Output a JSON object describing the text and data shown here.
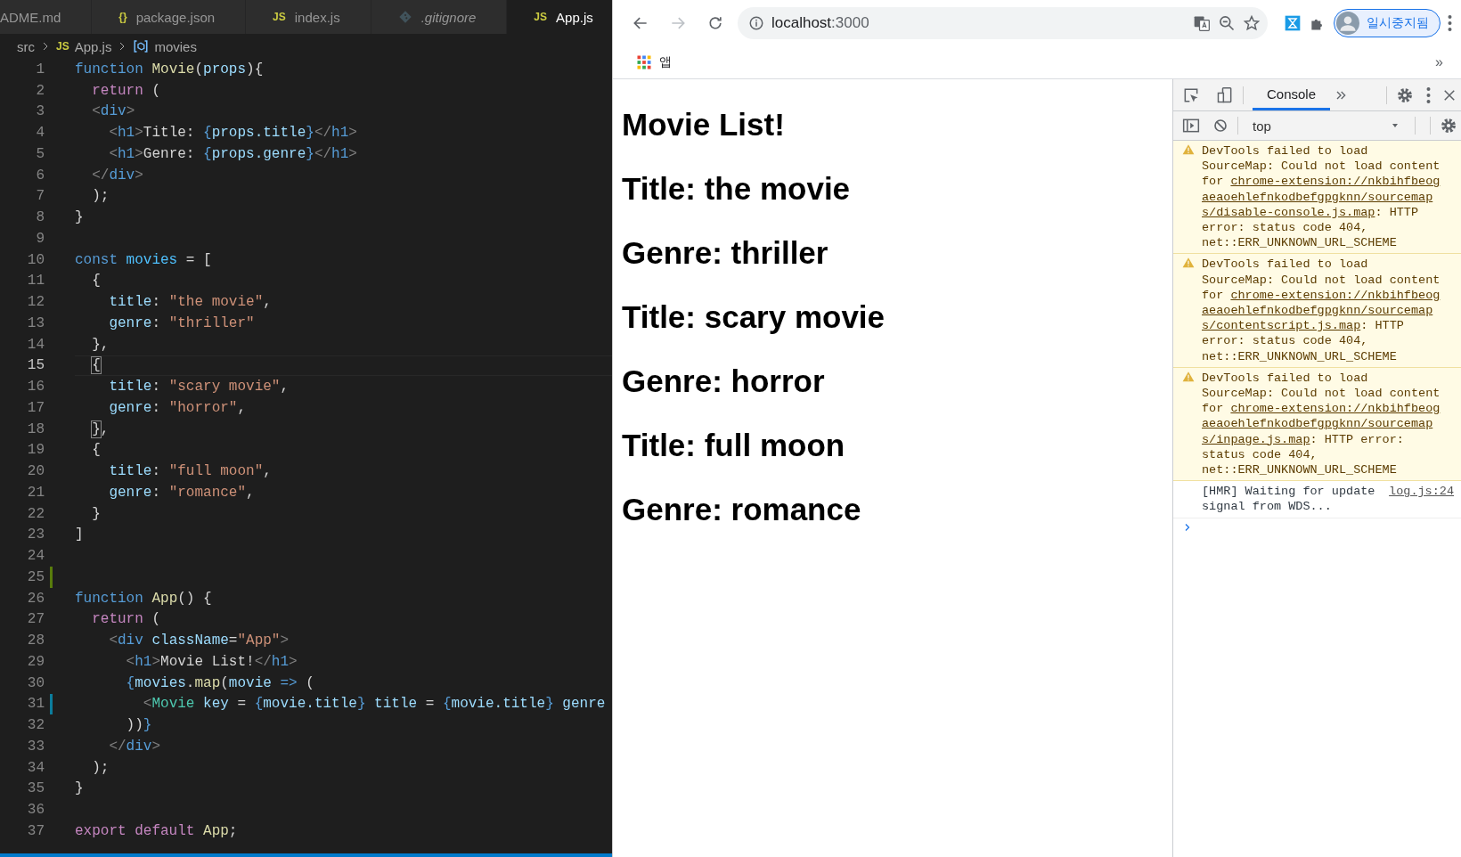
{
  "editor": {
    "tabs": [
      {
        "label": "ADME.md",
        "selected": false,
        "preview": false
      },
      {
        "badge": "{}",
        "label": "package.json",
        "selected": false,
        "preview": false
      },
      {
        "badge": "JS",
        "label": "index.js",
        "selected": false,
        "preview": false
      },
      {
        "kind": "git",
        "label": ".gitignore",
        "selected": false,
        "preview": true
      },
      {
        "badge": "JS",
        "label": "App.js",
        "selected": true,
        "preview": false
      }
    ],
    "breadcrumb": [
      {
        "label": "src"
      },
      {
        "badge": "JS",
        "label": "App.js"
      },
      {
        "kind": "variable",
        "label": "movies"
      }
    ],
    "lines": [
      {
        "number": "1",
        "tokens": [
          {
            "kind": "kw",
            "text": "function "
          },
          {
            "kind": "fn",
            "text": "Movie"
          },
          {
            "kind": "punc",
            "text": "("
          },
          {
            "kind": "var",
            "text": "props"
          },
          {
            "kind": "punc",
            "text": "){"
          }
        ]
      },
      {
        "number": "2",
        "tokens": [
          {
            "kind": "ctrl",
            "text": "  return"
          },
          {
            "kind": "punc",
            "text": " ("
          }
        ]
      },
      {
        "number": "3",
        "tokens": [
          {
            "kind": "tag",
            "text": "  <"
          },
          {
            "kind": "kw",
            "text": "div"
          },
          {
            "kind": "tag",
            "text": ">"
          }
        ]
      },
      {
        "number": "4",
        "tokens": [
          {
            "kind": "tag",
            "text": "    <"
          },
          {
            "kind": "kw",
            "text": "h1"
          },
          {
            "kind": "tag",
            "text": ">"
          },
          {
            "kind": "punc",
            "text": "Title: "
          },
          {
            "kind": "kw",
            "text": "{"
          },
          {
            "kind": "var",
            "text": "props.title"
          },
          {
            "kind": "kw",
            "text": "}"
          },
          {
            "kind": "tag",
            "text": "</"
          },
          {
            "kind": "kw",
            "text": "h1"
          },
          {
            "kind": "tag",
            "text": ">"
          }
        ]
      },
      {
        "number": "5",
        "tokens": [
          {
            "kind": "tag",
            "text": "    <"
          },
          {
            "kind": "kw",
            "text": "h1"
          },
          {
            "kind": "tag",
            "text": ">"
          },
          {
            "kind": "punc",
            "text": "Genre: "
          },
          {
            "kind": "kw",
            "text": "{"
          },
          {
            "kind": "var",
            "text": "props.genre"
          },
          {
            "kind": "kw",
            "text": "}"
          },
          {
            "kind": "tag",
            "text": "</"
          },
          {
            "kind": "kw",
            "text": "h1"
          },
          {
            "kind": "tag",
            "text": ">"
          }
        ]
      },
      {
        "number": "6",
        "tokens": [
          {
            "kind": "tag",
            "text": "  </"
          },
          {
            "kind": "kw",
            "text": "div"
          },
          {
            "kind": "tag",
            "text": ">"
          }
        ]
      },
      {
        "number": "7",
        "tokens": [
          {
            "kind": "punc",
            "text": "  );"
          }
        ]
      },
      {
        "number": "8",
        "tokens": [
          {
            "kind": "punc",
            "text": "}"
          }
        ]
      },
      {
        "number": "9"
      },
      {
        "number": "10",
        "tokens": [
          {
            "kind": "kw",
            "text": "const "
          },
          {
            "kind": "const",
            "text": "movies"
          },
          {
            "kind": "punc",
            "text": " = ["
          }
        ]
      },
      {
        "number": "11",
        "tokens": [
          {
            "kind": "punc",
            "text": "  {"
          }
        ]
      },
      {
        "number": "12",
        "tokens": [
          {
            "kind": "var",
            "text": "    title"
          },
          {
            "kind": "punc",
            "text": ": "
          },
          {
            "kind": "str",
            "text": "\"the movie\""
          },
          {
            "kind": "punc",
            "text": ","
          }
        ]
      },
      {
        "number": "13",
        "tokens": [
          {
            "kind": "var",
            "text": "    genre"
          },
          {
            "kind": "punc",
            "text": ": "
          },
          {
            "kind": "str",
            "text": "\"thriller\""
          }
        ]
      },
      {
        "number": "14",
        "tokens": [
          {
            "kind": "punc",
            "text": "  },"
          }
        ]
      },
      {
        "number": "15",
        "current": true,
        "tokens": [
          {
            "kind": "punc",
            "text": "  {",
            "match": true
          }
        ]
      },
      {
        "number": "16",
        "tokens": [
          {
            "kind": "var",
            "text": "    title"
          },
          {
            "kind": "punc",
            "text": ": "
          },
          {
            "kind": "str",
            "text": "\"scary movie\""
          },
          {
            "kind": "punc",
            "text": ","
          }
        ]
      },
      {
        "number": "17",
        "tokens": [
          {
            "kind": "var",
            "text": "    genre"
          },
          {
            "kind": "punc",
            "text": ": "
          },
          {
            "kind": "str",
            "text": "\"horror\""
          },
          {
            "kind": "punc",
            "text": ","
          }
        ]
      },
      {
        "number": "18",
        "tokens": [
          {
            "kind": "punc",
            "text": "  }",
            "match": true
          },
          {
            "kind": "punc",
            "text": ","
          }
        ]
      },
      {
        "number": "19",
        "tokens": [
          {
            "kind": "punc",
            "text": "  {"
          }
        ]
      },
      {
        "number": "20",
        "tokens": [
          {
            "kind": "var",
            "text": "    title"
          },
          {
            "kind": "punc",
            "text": ": "
          },
          {
            "kind": "str",
            "text": "\"full moon\""
          },
          {
            "kind": "punc",
            "text": ","
          }
        ]
      },
      {
        "number": "21",
        "tokens": [
          {
            "kind": "var",
            "text": "    genre"
          },
          {
            "kind": "punc",
            "text": ": "
          },
          {
            "kind": "str",
            "text": "\"romance\""
          },
          {
            "kind": "punc",
            "text": ","
          }
        ]
      },
      {
        "number": "22",
        "tokens": [
          {
            "kind": "punc",
            "text": "  }"
          }
        ]
      },
      {
        "number": "23",
        "tokens": [
          {
            "kind": "punc",
            "text": "]"
          }
        ]
      },
      {
        "number": "24"
      },
      {
        "number": "25",
        "added": true
      },
      {
        "number": "26",
        "tokens": [
          {
            "kind": "kw",
            "text": "function "
          },
          {
            "kind": "fn",
            "text": "App"
          },
          {
            "kind": "punc",
            "text": "() {"
          }
        ]
      },
      {
        "number": "27",
        "tokens": [
          {
            "kind": "ctrl",
            "text": "  return"
          },
          {
            "kind": "punc",
            "text": " ("
          }
        ]
      },
      {
        "number": "28",
        "tokens": [
          {
            "kind": "tag",
            "text": "    <"
          },
          {
            "kind": "kw",
            "text": "div"
          },
          {
            "kind": "var",
            "text": " className"
          },
          {
            "kind": "punc",
            "text": "="
          },
          {
            "kind": "str",
            "text": "\"App\""
          },
          {
            "kind": "tag",
            "text": ">"
          }
        ]
      },
      {
        "number": "29",
        "tokens": [
          {
            "kind": "tag",
            "text": "      <"
          },
          {
            "kind": "kw",
            "text": "h1"
          },
          {
            "kind": "tag",
            "text": ">"
          },
          {
            "kind": "punc",
            "text": "Movie List!"
          },
          {
            "kind": "tag",
            "text": "</"
          },
          {
            "kind": "kw",
            "text": "h1"
          },
          {
            "kind": "tag",
            "text": ">"
          }
        ]
      },
      {
        "number": "30",
        "tokens": [
          {
            "kind": "kw",
            "text": "      {"
          },
          {
            "kind": "var",
            "text": "movies"
          },
          {
            "kind": "punc",
            "text": "."
          },
          {
            "kind": "fn",
            "text": "map"
          },
          {
            "kind": "punc",
            "text": "("
          },
          {
            "kind": "var",
            "text": "movie"
          },
          {
            "kind": "kw",
            "text": " =>"
          },
          {
            "kind": "punc",
            "text": " ("
          }
        ]
      },
      {
        "number": "31",
        "modified": true,
        "tokens": [
          {
            "kind": "tag",
            "text": "        <"
          },
          {
            "kind": "comp",
            "text": "Movie"
          },
          {
            "kind": "var",
            "text": " key"
          },
          {
            "kind": "punc",
            "text": " = "
          },
          {
            "kind": "kw",
            "text": "{"
          },
          {
            "kind": "var",
            "text": "movie.title"
          },
          {
            "kind": "kw",
            "text": "}"
          },
          {
            "kind": "var",
            "text": " title"
          },
          {
            "kind": "punc",
            "text": " = "
          },
          {
            "kind": "kw",
            "text": "{"
          },
          {
            "kind": "var",
            "text": "movie.title"
          },
          {
            "kind": "kw",
            "text": "}"
          },
          {
            "kind": "var",
            "text": " genre"
          }
        ]
      },
      {
        "number": "32",
        "tokens": [
          {
            "kind": "punc",
            "text": "      ))"
          },
          {
            "kind": "kw",
            "text": "}"
          }
        ]
      },
      {
        "number": "33",
        "tokens": [
          {
            "kind": "tag",
            "text": "    </"
          },
          {
            "kind": "kw",
            "text": "div"
          },
          {
            "kind": "tag",
            "text": ">"
          }
        ]
      },
      {
        "number": "34",
        "tokens": [
          {
            "kind": "punc",
            "text": "  );"
          }
        ]
      },
      {
        "number": "35",
        "tokens": [
          {
            "kind": "punc",
            "text": "}"
          }
        ]
      },
      {
        "number": "36"
      },
      {
        "number": "37",
        "tokens": [
          {
            "kind": "ctrl",
            "text": "export default "
          },
          {
            "kind": "fn",
            "text": "App"
          },
          {
            "kind": "punc",
            "text": ";"
          }
        ]
      }
    ]
  },
  "browser": {
    "address": {
      "host": "localhost",
      "port": ":3000"
    },
    "profile": "일시중지됨",
    "bookmarks": [
      {
        "label": "앱"
      }
    ],
    "bookmarks_more": "»",
    "page": {
      "headings": [
        "Movie List!",
        "Title: the movie",
        "Genre: thriller",
        "Title: scary movie",
        "Genre: horror",
        "Title: full moon",
        "Genre: romance"
      ]
    },
    "devtools": {
      "tabs": [
        {
          "label": "Console",
          "selected": true
        }
      ],
      "context": "top",
      "messages": [
        {
          "kind": "warning",
          "before": "DevTools failed to load SourceMap: Could not load content for ",
          "link": "chrome-extension://nkbihfbeogaeaoehlefnkodbefgpgknn/sourcemaps/disable-console.js.map",
          "after": ": HTTP error: status code 404, net::ERR_UNKNOWN_URL_SCHEME"
        },
        {
          "kind": "warning",
          "before": "DevTools failed to load SourceMap: Could not load content for ",
          "link": "chrome-extension://nkbihfbeogaeaoehlefnkodbefgpgknn/sourcemaps/contentscript.js.map",
          "after": ": HTTP error: status code 404, net::ERR_UNKNOWN_URL_SCHEME"
        },
        {
          "kind": "warning",
          "before": "DevTools failed to load SourceMap: Could not load content for ",
          "link": "chrome-extension://nkbihfbeogaeaoehlefnkodbefgpgknn/sourcemaps/inpage.js.map",
          "after": ": HTTP error: status code 404, net::ERR_UNKNOWN_URL_SCHEME"
        },
        {
          "kind": "info",
          "before": "[HMR] Waiting for update signal from WDS...",
          "source": "log.js:24"
        }
      ]
    }
  }
}
